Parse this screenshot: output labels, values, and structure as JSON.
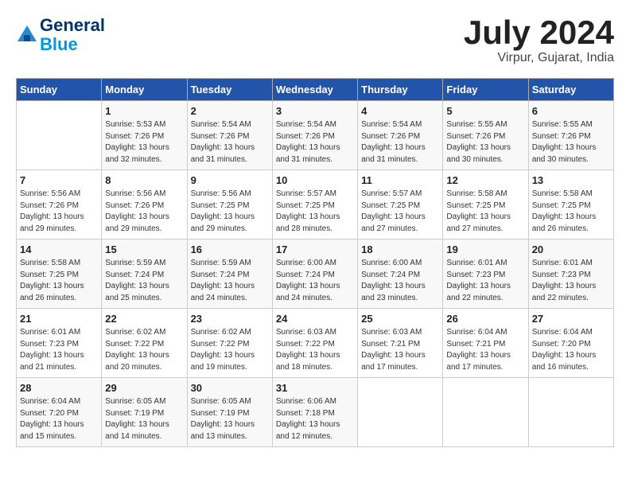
{
  "header": {
    "logo_line1": "General",
    "logo_line2": "Blue",
    "month_title": "July 2024",
    "location": "Virpur, Gujarat, India"
  },
  "weekdays": [
    "Sunday",
    "Monday",
    "Tuesday",
    "Wednesday",
    "Thursday",
    "Friday",
    "Saturday"
  ],
  "weeks": [
    [
      {
        "day": "",
        "sunrise": "",
        "sunset": "",
        "daylight": ""
      },
      {
        "day": "1",
        "sunrise": "Sunrise: 5:53 AM",
        "sunset": "Sunset: 7:26 PM",
        "daylight": "Daylight: 13 hours and 32 minutes."
      },
      {
        "day": "2",
        "sunrise": "Sunrise: 5:54 AM",
        "sunset": "Sunset: 7:26 PM",
        "daylight": "Daylight: 13 hours and 31 minutes."
      },
      {
        "day": "3",
        "sunrise": "Sunrise: 5:54 AM",
        "sunset": "Sunset: 7:26 PM",
        "daylight": "Daylight: 13 hours and 31 minutes."
      },
      {
        "day": "4",
        "sunrise": "Sunrise: 5:54 AM",
        "sunset": "Sunset: 7:26 PM",
        "daylight": "Daylight: 13 hours and 31 minutes."
      },
      {
        "day": "5",
        "sunrise": "Sunrise: 5:55 AM",
        "sunset": "Sunset: 7:26 PM",
        "daylight": "Daylight: 13 hours and 30 minutes."
      },
      {
        "day": "6",
        "sunrise": "Sunrise: 5:55 AM",
        "sunset": "Sunset: 7:26 PM",
        "daylight": "Daylight: 13 hours and 30 minutes."
      }
    ],
    [
      {
        "day": "7",
        "sunrise": "Sunrise: 5:56 AM",
        "sunset": "Sunset: 7:26 PM",
        "daylight": "Daylight: 13 hours and 29 minutes."
      },
      {
        "day": "8",
        "sunrise": "Sunrise: 5:56 AM",
        "sunset": "Sunset: 7:26 PM",
        "daylight": "Daylight: 13 hours and 29 minutes."
      },
      {
        "day": "9",
        "sunrise": "Sunrise: 5:56 AM",
        "sunset": "Sunset: 7:25 PM",
        "daylight": "Daylight: 13 hours and 29 minutes."
      },
      {
        "day": "10",
        "sunrise": "Sunrise: 5:57 AM",
        "sunset": "Sunset: 7:25 PM",
        "daylight": "Daylight: 13 hours and 28 minutes."
      },
      {
        "day": "11",
        "sunrise": "Sunrise: 5:57 AM",
        "sunset": "Sunset: 7:25 PM",
        "daylight": "Daylight: 13 hours and 27 minutes."
      },
      {
        "day": "12",
        "sunrise": "Sunrise: 5:58 AM",
        "sunset": "Sunset: 7:25 PM",
        "daylight": "Daylight: 13 hours and 27 minutes."
      },
      {
        "day": "13",
        "sunrise": "Sunrise: 5:58 AM",
        "sunset": "Sunset: 7:25 PM",
        "daylight": "Daylight: 13 hours and 26 minutes."
      }
    ],
    [
      {
        "day": "14",
        "sunrise": "Sunrise: 5:58 AM",
        "sunset": "Sunset: 7:25 PM",
        "daylight": "Daylight: 13 hours and 26 minutes."
      },
      {
        "day": "15",
        "sunrise": "Sunrise: 5:59 AM",
        "sunset": "Sunset: 7:24 PM",
        "daylight": "Daylight: 13 hours and 25 minutes."
      },
      {
        "day": "16",
        "sunrise": "Sunrise: 5:59 AM",
        "sunset": "Sunset: 7:24 PM",
        "daylight": "Daylight: 13 hours and 24 minutes."
      },
      {
        "day": "17",
        "sunrise": "Sunrise: 6:00 AM",
        "sunset": "Sunset: 7:24 PM",
        "daylight": "Daylight: 13 hours and 24 minutes."
      },
      {
        "day": "18",
        "sunrise": "Sunrise: 6:00 AM",
        "sunset": "Sunset: 7:24 PM",
        "daylight": "Daylight: 13 hours and 23 minutes."
      },
      {
        "day": "19",
        "sunrise": "Sunrise: 6:01 AM",
        "sunset": "Sunset: 7:23 PM",
        "daylight": "Daylight: 13 hours and 22 minutes."
      },
      {
        "day": "20",
        "sunrise": "Sunrise: 6:01 AM",
        "sunset": "Sunset: 7:23 PM",
        "daylight": "Daylight: 13 hours and 22 minutes."
      }
    ],
    [
      {
        "day": "21",
        "sunrise": "Sunrise: 6:01 AM",
        "sunset": "Sunset: 7:23 PM",
        "daylight": "Daylight: 13 hours and 21 minutes."
      },
      {
        "day": "22",
        "sunrise": "Sunrise: 6:02 AM",
        "sunset": "Sunset: 7:22 PM",
        "daylight": "Daylight: 13 hours and 20 minutes."
      },
      {
        "day": "23",
        "sunrise": "Sunrise: 6:02 AM",
        "sunset": "Sunset: 7:22 PM",
        "daylight": "Daylight: 13 hours and 19 minutes."
      },
      {
        "day": "24",
        "sunrise": "Sunrise: 6:03 AM",
        "sunset": "Sunset: 7:22 PM",
        "daylight": "Daylight: 13 hours and 18 minutes."
      },
      {
        "day": "25",
        "sunrise": "Sunrise: 6:03 AM",
        "sunset": "Sunset: 7:21 PM",
        "daylight": "Daylight: 13 hours and 17 minutes."
      },
      {
        "day": "26",
        "sunrise": "Sunrise: 6:04 AM",
        "sunset": "Sunset: 7:21 PM",
        "daylight": "Daylight: 13 hours and 17 minutes."
      },
      {
        "day": "27",
        "sunrise": "Sunrise: 6:04 AM",
        "sunset": "Sunset: 7:20 PM",
        "daylight": "Daylight: 13 hours and 16 minutes."
      }
    ],
    [
      {
        "day": "28",
        "sunrise": "Sunrise: 6:04 AM",
        "sunset": "Sunset: 7:20 PM",
        "daylight": "Daylight: 13 hours and 15 minutes."
      },
      {
        "day": "29",
        "sunrise": "Sunrise: 6:05 AM",
        "sunset": "Sunset: 7:19 PM",
        "daylight": "Daylight: 13 hours and 14 minutes."
      },
      {
        "day": "30",
        "sunrise": "Sunrise: 6:05 AM",
        "sunset": "Sunset: 7:19 PM",
        "daylight": "Daylight: 13 hours and 13 minutes."
      },
      {
        "day": "31",
        "sunrise": "Sunrise: 6:06 AM",
        "sunset": "Sunset: 7:18 PM",
        "daylight": "Daylight: 13 hours and 12 minutes."
      },
      {
        "day": "",
        "sunrise": "",
        "sunset": "",
        "daylight": ""
      },
      {
        "day": "",
        "sunrise": "",
        "sunset": "",
        "daylight": ""
      },
      {
        "day": "",
        "sunrise": "",
        "sunset": "",
        "daylight": ""
      }
    ]
  ]
}
